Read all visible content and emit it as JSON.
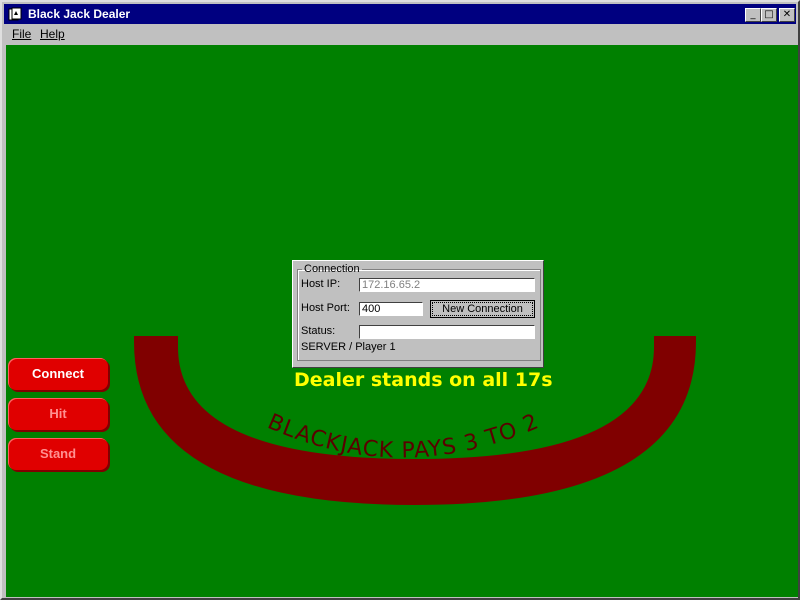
{
  "window": {
    "title": "Black Jack Dealer"
  },
  "menu": {
    "file_label": "File",
    "help_label": "Help"
  },
  "table": {
    "arc_text": "BLACKJACK  PAYS  3 TO 2",
    "dealer_rule": "Dealer stands on all 17s",
    "felt_color": "#008000",
    "rail_color": "#800000"
  },
  "connection": {
    "group_label": "Connection",
    "host_ip_label": "Host IP:",
    "host_ip_value": "172.16.65.2",
    "host_port_label": "Host Port:",
    "host_port_value": "400",
    "new_connection_label": "New Connection",
    "status_label": "Status:",
    "status_value": "",
    "role_text": "SERVER / Player 1"
  },
  "controls": {
    "connect_label": "Connect",
    "hit_label": "Hit",
    "stand_label": "Stand"
  }
}
